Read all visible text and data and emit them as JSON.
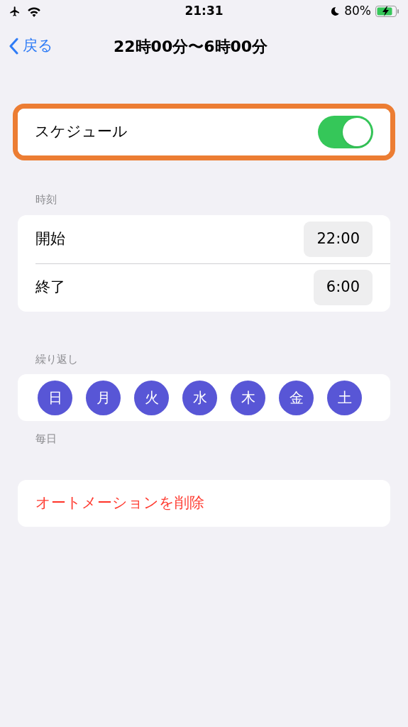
{
  "status_bar": {
    "time": "21:31",
    "battery": "80%"
  },
  "nav": {
    "back": "戻る",
    "title": "22時00分〜6時00分"
  },
  "schedule": {
    "label": "スケジュール",
    "on": true,
    "highlighted": true
  },
  "time_section": {
    "header": "時刻",
    "rows": [
      {
        "label": "開始",
        "value": "22:00"
      },
      {
        "label": "終了",
        "value": "6:00"
      }
    ]
  },
  "repeat_section": {
    "header": "繰り返し",
    "days": [
      {
        "label": "日",
        "selected": true
      },
      {
        "label": "月",
        "selected": true
      },
      {
        "label": "火",
        "selected": true
      },
      {
        "label": "水",
        "selected": true
      },
      {
        "label": "木",
        "selected": true
      },
      {
        "label": "金",
        "selected": true
      },
      {
        "label": "土",
        "selected": true
      }
    ],
    "footer": "毎日"
  },
  "delete_button": "オートメーションを削除"
}
